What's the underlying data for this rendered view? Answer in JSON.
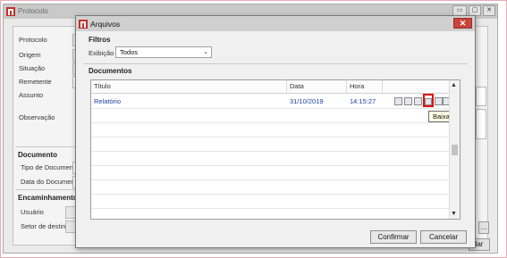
{
  "main_window": {
    "title": "Protocolo",
    "labels": {
      "protocolo": "Protocolo",
      "origem": "Origem",
      "situacao": "Situação",
      "remetente": "Remetente",
      "assunto": "Assunto",
      "observacao": "Observação",
      "tipo_documento": "Tipo de Documento",
      "data_documento": "Data do Documento",
      "usuario": "Usuário",
      "setor_destino": "Setor de destino"
    },
    "sections": {
      "documento": "Documento",
      "encaminhamento": "Encaminhamento"
    },
    "field_fragments": {
      "origem": "I",
      "situacao": "P",
      "remetente": "L",
      "data_documento": "3"
    },
    "ellipsis_button": "...",
    "cancel_fragment": "lar"
  },
  "dialog": {
    "title": "Arquivos",
    "close_glyph": "✕",
    "filters": {
      "title": "Filtros",
      "exibicao_label": "Exibição",
      "exibicao_value": "Todos"
    },
    "documents": {
      "title": "Documentos",
      "columns": [
        "Título",
        "Data",
        "Hora"
      ],
      "rows": [
        {
          "titulo": "Relatório",
          "data": "31/10/2019",
          "hora": "14:15:27"
        }
      ]
    },
    "tooltip": "Baixar",
    "buttons": {
      "confirmar": "Confirmar",
      "cancelar": "Cancelar"
    }
  },
  "colors": {
    "highlight": "#e01010",
    "link_text": "#1f3fa0",
    "close_button": "#c7453a",
    "app_icon": "#c0302a"
  }
}
